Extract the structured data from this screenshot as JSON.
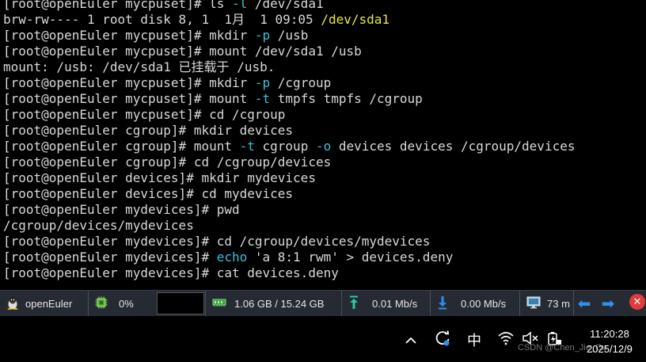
{
  "terminal": {
    "lines": [
      [
        {
          "t": "[root@openEuler mycpuset]# ls ",
          "c": "def"
        },
        {
          "t": "-l",
          "c": "opt"
        },
        {
          "t": " /dev/sda1",
          "c": "def"
        }
      ],
      [
        {
          "t": "brw-rw---- 1 root disk 8, 1  1月  1 09:05 ",
          "c": "def"
        },
        {
          "t": "/dev/sda1",
          "c": "yel"
        }
      ],
      [
        {
          "t": "[root@openEuler mycpuset]# mkdir ",
          "c": "def"
        },
        {
          "t": "-p",
          "c": "opt"
        },
        {
          "t": " /usb",
          "c": "def"
        }
      ],
      [
        {
          "t": "[root@openEuler mycpuset]# mount /dev/sda1 /usb",
          "c": "def"
        }
      ],
      [
        {
          "t": "mount: /usb: /dev/sda1 已挂载于 /usb.",
          "c": "def"
        }
      ],
      [
        {
          "t": "[root@openEuler mycpuset]# mkdir ",
          "c": "def"
        },
        {
          "t": "-p",
          "c": "opt"
        },
        {
          "t": " /cgroup",
          "c": "def"
        }
      ],
      [
        {
          "t": "[root@openEuler mycpuset]# mount ",
          "c": "def"
        },
        {
          "t": "-t",
          "c": "opt"
        },
        {
          "t": " tmpfs tmpfs /cgroup",
          "c": "def"
        }
      ],
      [
        {
          "t": "[root@openEuler mycpuset]# cd /cgroup",
          "c": "def"
        }
      ],
      [
        {
          "t": "[root@openEuler cgroup]# mkdir devices",
          "c": "def"
        }
      ],
      [
        {
          "t": "[root@openEuler cgroup]# mount ",
          "c": "def"
        },
        {
          "t": "-t",
          "c": "opt"
        },
        {
          "t": " cgroup ",
          "c": "def"
        },
        {
          "t": "-o",
          "c": "opt"
        },
        {
          "t": " devices devices /cgroup/devices",
          "c": "def"
        }
      ],
      [
        {
          "t": "[root@openEuler cgroup]# cd /cgroup/devices",
          "c": "def"
        }
      ],
      [
        {
          "t": "[root@openEuler devices]# mkdir mydevices",
          "c": "def"
        }
      ],
      [
        {
          "t": "[root@openEuler devices]# cd mydevices",
          "c": "def"
        }
      ],
      [
        {
          "t": "[root@openEuler mydevices]# pwd",
          "c": "def"
        }
      ],
      [
        {
          "t": "/cgroup/devices/mydevices",
          "c": "def"
        }
      ],
      [
        {
          "t": "[root@openEuler mydevices]# cd /cgroup/devices/mydevices",
          "c": "def"
        }
      ],
      [
        {
          "t": "[root@openEuler mydevices]# ",
          "c": "def"
        },
        {
          "t": "echo",
          "c": "cmd"
        },
        {
          "t": " 'a 8:1 rwm' > devices.deny",
          "c": "def"
        }
      ],
      [
        {
          "t": "[root@openEuler mydevices]# cat devices.deny",
          "c": "def"
        }
      ]
    ]
  },
  "status_bar": {
    "session_name": "openEuler",
    "cpu_usage": "0%",
    "memory": "1.06 GB / 15.24 GB",
    "upload_speed": "0.01 Mb/s",
    "download_speed": "0.00 Mb/s",
    "uptime_partial": "73 m",
    "nav_left_icon": "arrow-left-icon",
    "nav_right_icon": "arrow-right-icon",
    "close_icon": "close-icon"
  },
  "taskbar": {
    "tray_chevron": "^",
    "input_method": "中",
    "time": "11:20:28",
    "date": "2025/12/9",
    "watermark": "CSDN @Chen_Jie_Ou"
  },
  "colors": {
    "terminal_bg": "#000000",
    "terminal_text": "#d8d8d8",
    "option_cyan": "#33c3d9",
    "path_yellow": "#e8e83a",
    "status_bg": "#262a33",
    "accent_blue": "#2f8ff0",
    "close_red": "#e23b3b"
  }
}
